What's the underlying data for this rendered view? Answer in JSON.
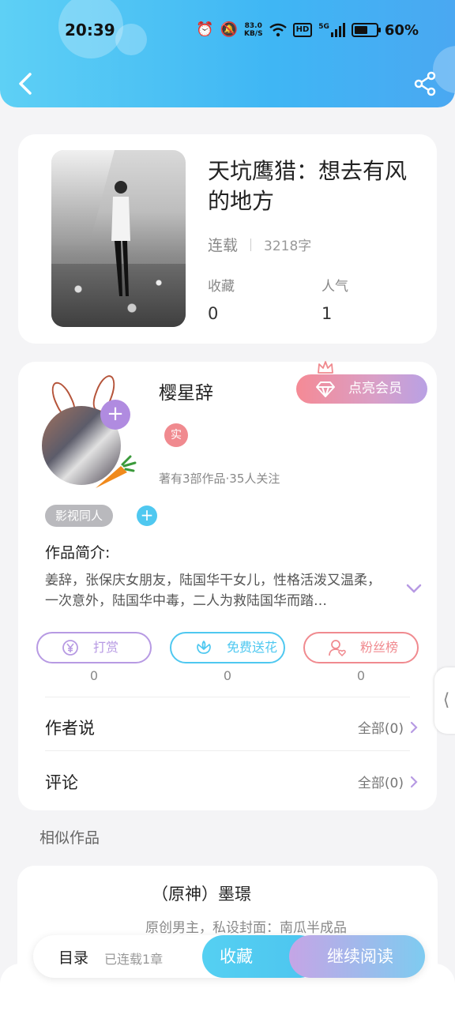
{
  "status_bar": {
    "time": "20:39",
    "net_speed_value": "83.0",
    "net_speed_unit": "KB/S",
    "hd": "HD",
    "network": "5G",
    "battery_text": "60%",
    "battery_level": 0.6
  },
  "book": {
    "title": "天坑鹰猎：想去有风的地方",
    "status": "连载",
    "word_count": "3218字",
    "favorites_label": "收藏",
    "favorites_value": "0",
    "popularity_label": "人气",
    "popularity_value": "1"
  },
  "author": {
    "name": "樱星辞",
    "verified_badge": "实",
    "stats": "著有3部作品·35人关注",
    "vip_button": "点亮会员",
    "tag": "影视同人",
    "intro_title": "作品简介:",
    "intro_text": "姜辞，张保庆女朋友，陆国华干女儿，性格活泼又温柔，一次意外，陆国华中毒，二人为救陆国华而踏…",
    "actions": [
      {
        "label": "打赏",
        "count": "0",
        "color": "#b79ae3",
        "icon": "yen-coin-icon"
      },
      {
        "label": "免费送花",
        "count": "0",
        "color": "#4fc8f0",
        "icon": "flower-icon"
      },
      {
        "label": "粉丝榜",
        "count": "0",
        "color": "#f08a8f",
        "icon": "fan-user-icon"
      }
    ],
    "author_says_label": "作者说",
    "author_says_link": "全部(0)",
    "comments_label": "评论",
    "comments_link": "全部(0)"
  },
  "similar": {
    "section_title": "相似作品",
    "items": [
      {
        "title": "（原神）墨璟",
        "desc": "原创男主，私设封面：南瓜半成品"
      }
    ]
  },
  "bottom_bar": {
    "toc_label": "目录",
    "toc_sub": "已连载1章",
    "collect_label": "收藏",
    "read_label": "继续阅读"
  },
  "colors": {
    "header_blue": "#3fb6f4",
    "accent_purple": "#b79ae3",
    "accent_cyan": "#4fc8f0",
    "accent_pink": "#f08a8f"
  }
}
